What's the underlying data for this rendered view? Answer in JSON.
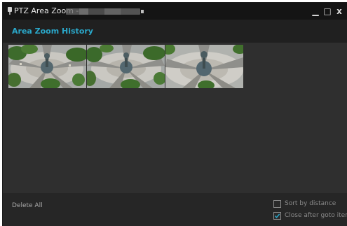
{
  "window": {
    "title": "PTZ Area Zoom -",
    "controls": {
      "minimize": "▁",
      "maximize": "□",
      "close": "x"
    }
  },
  "header": {
    "title": "Area Zoom History"
  },
  "history": {
    "items": [
      {
        "icon": "plaza-fountain-thumbnail"
      },
      {
        "icon": "plaza-fountain-thumbnail"
      },
      {
        "icon": "plaza-fountain-thumbnail"
      }
    ]
  },
  "footer": {
    "delete_all": "Delete All",
    "sort_by_distance": {
      "label": "Sort by distance",
      "checked": false
    },
    "close_after_goto": {
      "label": "Close after goto item",
      "checked": true
    }
  },
  "colors": {
    "accent": "#2aa7c9",
    "titlebar": "#141414",
    "background": "#2f2f2f"
  }
}
